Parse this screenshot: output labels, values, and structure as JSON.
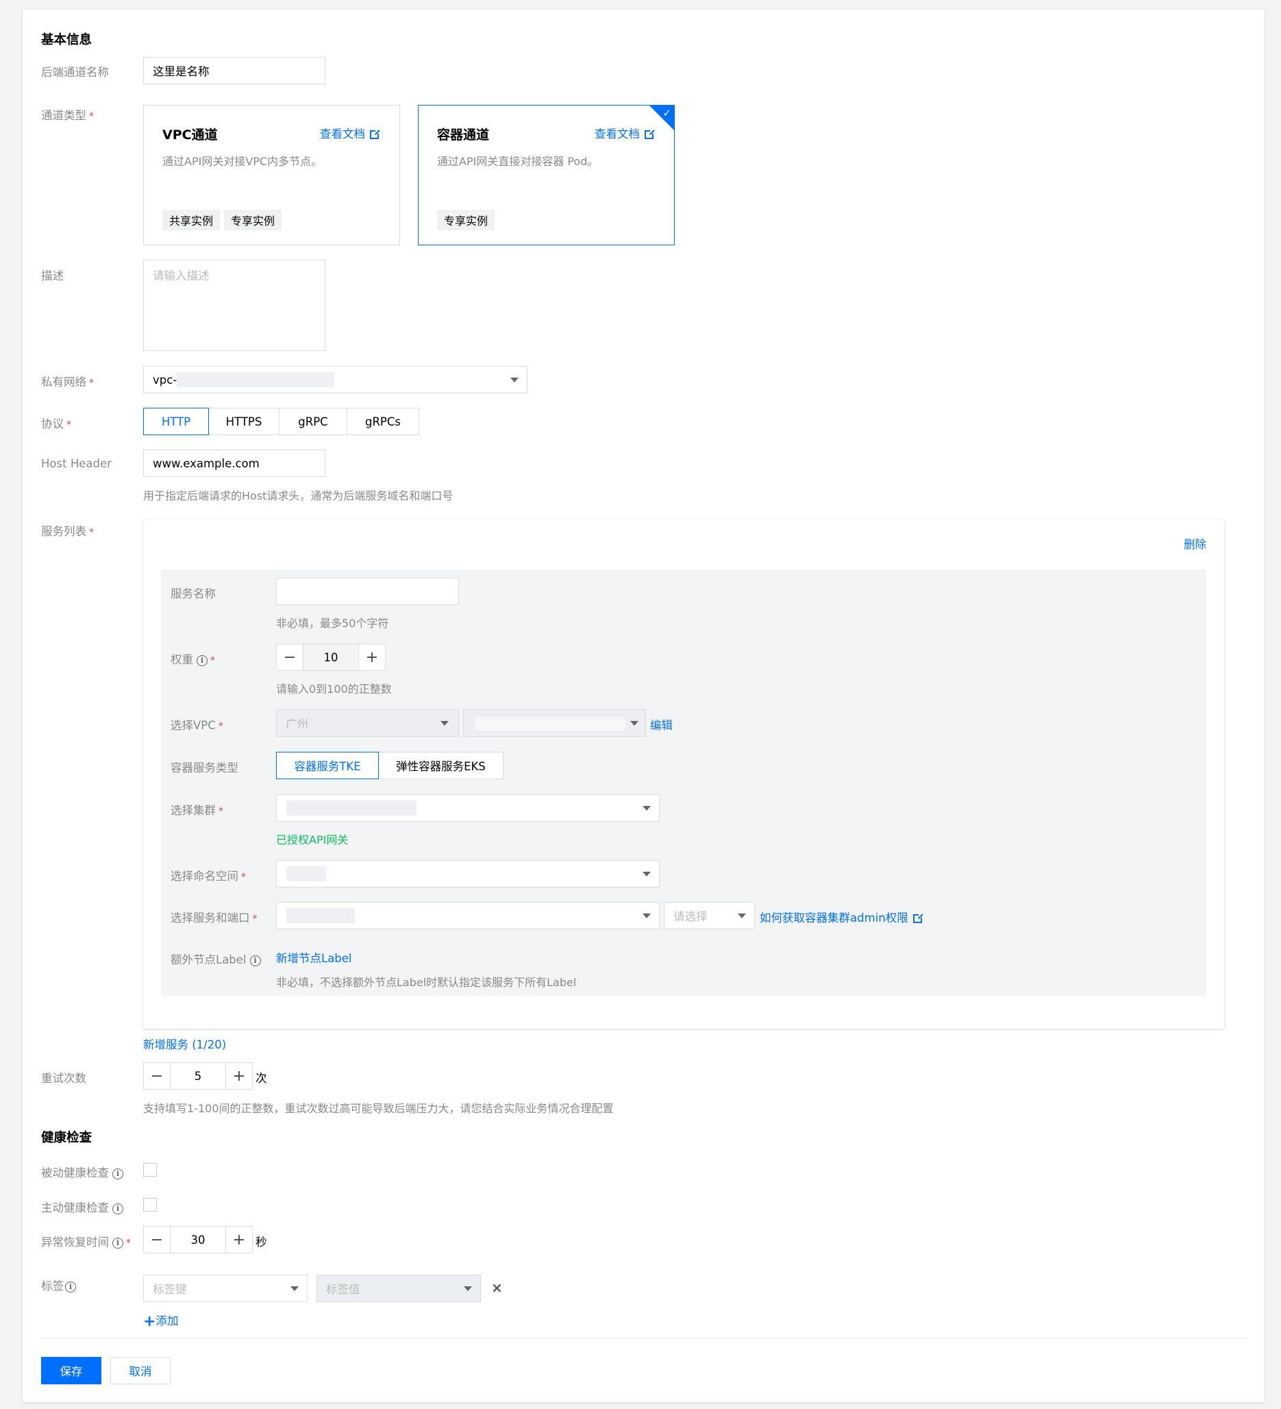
{
  "basic": {
    "section_title": "基本信息",
    "name_label": "后端通道名称",
    "name_value": "这里是名称",
    "type_label": "通道类型",
    "required_mark": "*",
    "types": [
      {
        "title": "VPC通道",
        "doc": "查看文档",
        "desc": "通过API网关对接VPC内多节点。",
        "tags": [
          "共享实例",
          "专享实例"
        ],
        "selected": false
      },
      {
        "title": "容器通道",
        "doc": "查看文档",
        "desc": "通过API网关直接对接容器 Pod。",
        "tags": [
          "专享实例"
        ],
        "selected": true
      }
    ],
    "desc_label": "描述",
    "desc_placeholder": "请输入描述",
    "vpc_label": "私有网络",
    "vpc_value": "vpc-",
    "protocol_label": "协议",
    "protocols": [
      "HTTP",
      "HTTPS",
      "gRPC",
      "gRPCs"
    ],
    "protocol_active": "HTTP",
    "host_label": "Host Header",
    "host_value": "www.example.com",
    "host_hint": "用于指定后端请求的Host请求头，通常为后端服务域名和端口号"
  },
  "services": {
    "label": "服务列表",
    "delete": "删除",
    "service_name_label": "服务名称",
    "service_name_hint": "非必填，最多50个字符",
    "weight_label": "权重",
    "weight_value": "10",
    "weight_hint": "请输入0到100的正整数",
    "vpc_select_label": "选择VPC",
    "region_value": "广州",
    "edit": "编辑",
    "container_type_label": "容器服务类型",
    "container_types": [
      "容器服务TKE",
      "弹性容器服务EKS"
    ],
    "cluster_label": "选择集群",
    "cluster_hint": "已授权API网关",
    "namespace_label": "选择命名空间",
    "service_port_label": "选择服务和端口",
    "port_placeholder": "请选择",
    "admin_link": "如何获取容器集群admin权限",
    "extra_label_label": "额外节点Label",
    "add_label": "新增节点Label",
    "extra_label_hint": "非必填，不选择额外节点Label时默认指定该服务下所有Label",
    "add_service": "新增服务 (1/20)"
  },
  "retry": {
    "label": "重试次数",
    "value": "5",
    "unit": "次",
    "hint": "支持填写1-100间的正整数，重试次数过高可能导致后端压力大，请您结合实际业务情况合理配置"
  },
  "health": {
    "section_title": "健康检查",
    "passive_label": "被动健康检查",
    "active_label": "主动健康检查",
    "recover_label": "异常恢复时间",
    "recover_value": "30",
    "recover_unit": "秒"
  },
  "tags": {
    "label": "标签",
    "key_placeholder": "标签键",
    "value_placeholder": "标签值",
    "remove": "×",
    "add": "添加"
  },
  "footer": {
    "save": "保存",
    "cancel": "取消"
  },
  "colors": {
    "primary": "#006eff",
    "required": "#e54545",
    "success": "#0abf5b"
  }
}
